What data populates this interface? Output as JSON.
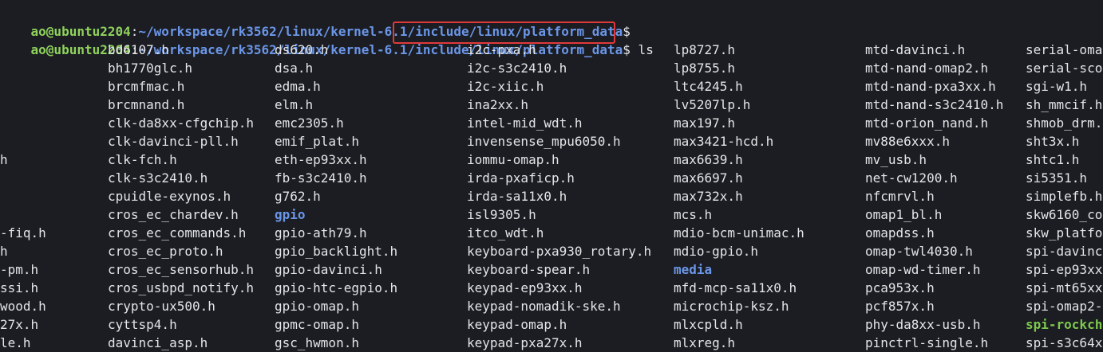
{
  "prompts": [
    {
      "user": "ao@ubuntu2204",
      "sep": ":",
      "path": "~/workspace/rk3562/linux/kernel-6.1/include/linux/platform_data",
      "symbol": "$",
      "command": ""
    },
    {
      "user": "ao@ubuntu2204",
      "sep": ":",
      "path": "~/workspace/rk3562/linux/kernel-6.1/include/linux/platform_data",
      "symbol": "$",
      "command": " ls"
    }
  ],
  "highlighted_text": "include/linux/platform_data",
  "colors": {
    "user": "#8fd25b",
    "directory": "#6b96e8",
    "executable": "#7dc94d",
    "highlight_border": "#e0393b",
    "background": "#1b1d22"
  },
  "columns": [
    {
      "entries": [
        {
          "name": ""
        },
        {
          "name": ""
        },
        {
          "name": ""
        },
        {
          "name": ""
        },
        {
          "name": ""
        },
        {
          "name": ""
        },
        {
          "name": "h"
        },
        {
          "name": ""
        },
        {
          "name": ""
        },
        {
          "name": ""
        },
        {
          "name": "-fiq.h"
        },
        {
          "name": "h"
        },
        {
          "name": "-pm.h"
        },
        {
          "name": "ssi.h"
        },
        {
          "name": "wood.h"
        },
        {
          "name": "27x.h"
        },
        {
          "name": "le.h"
        }
      ]
    },
    {
      "entries": [
        {
          "name": "bd6107.h"
        },
        {
          "name": "bh1770glc.h"
        },
        {
          "name": "brcmfmac.h"
        },
        {
          "name": "brcmnand.h"
        },
        {
          "name": "clk-da8xx-cfgchip.h"
        },
        {
          "name": "clk-davinci-pll.h"
        },
        {
          "name": "clk-fch.h"
        },
        {
          "name": "clk-s3c2410.h"
        },
        {
          "name": "cpuidle-exynos.h"
        },
        {
          "name": "cros_ec_chardev.h"
        },
        {
          "name": "cros_ec_commands.h"
        },
        {
          "name": "cros_ec_proto.h"
        },
        {
          "name": "cros_ec_sensorhub.h"
        },
        {
          "name": "cros_usbpd_notify.h"
        },
        {
          "name": "crypto-ux500.h"
        },
        {
          "name": "cyttsp4.h"
        },
        {
          "name": "davinci_asp.h"
        }
      ]
    },
    {
      "entries": [
        {
          "name": "ds620.h"
        },
        {
          "name": "dsa.h"
        },
        {
          "name": "edma.h"
        },
        {
          "name": "elm.h"
        },
        {
          "name": "emc2305.h"
        },
        {
          "name": "emif_plat.h"
        },
        {
          "name": "eth-ep93xx.h"
        },
        {
          "name": "fb-s3c2410.h"
        },
        {
          "name": "g762.h"
        },
        {
          "name": "gpio",
          "type": "dir"
        },
        {
          "name": "gpio-ath79.h"
        },
        {
          "name": "gpio_backlight.h"
        },
        {
          "name": "gpio-davinci.h"
        },
        {
          "name": "gpio-htc-egpio.h"
        },
        {
          "name": "gpio-omap.h"
        },
        {
          "name": "gpmc-omap.h"
        },
        {
          "name": "gsc_hwmon.h"
        }
      ]
    },
    {
      "entries": [
        {
          "name": "i2c-pxa.h"
        },
        {
          "name": "i2c-s3c2410.h"
        },
        {
          "name": "i2c-xiic.h"
        },
        {
          "name": "ina2xx.h"
        },
        {
          "name": "intel-mid_wdt.h"
        },
        {
          "name": "invensense_mpu6050.h"
        },
        {
          "name": "iommu-omap.h"
        },
        {
          "name": "irda-pxaficp.h"
        },
        {
          "name": "irda-sa11x0.h"
        },
        {
          "name": "isl9305.h"
        },
        {
          "name": "itco_wdt.h"
        },
        {
          "name": "keyboard-pxa930_rotary.h"
        },
        {
          "name": "keyboard-spear.h"
        },
        {
          "name": "keypad-ep93xx.h"
        },
        {
          "name": "keypad-nomadik-ske.h"
        },
        {
          "name": "keypad-omap.h"
        },
        {
          "name": "keypad-pxa27x.h"
        }
      ]
    },
    {
      "entries": [
        {
          "name": "lp8727.h"
        },
        {
          "name": "lp8755.h"
        },
        {
          "name": "ltc4245.h"
        },
        {
          "name": "lv5207lp.h"
        },
        {
          "name": "max197.h"
        },
        {
          "name": "max3421-hcd.h"
        },
        {
          "name": "max6639.h"
        },
        {
          "name": "max6697.h"
        },
        {
          "name": "max732x.h"
        },
        {
          "name": "mcs.h"
        },
        {
          "name": "mdio-bcm-unimac.h"
        },
        {
          "name": "mdio-gpio.h"
        },
        {
          "name": "media",
          "type": "dir"
        },
        {
          "name": "mfd-mcp-sa11x0.h"
        },
        {
          "name": "microchip-ksz.h"
        },
        {
          "name": "mlxcpld.h"
        },
        {
          "name": "mlxreg.h"
        }
      ]
    },
    {
      "entries": [
        {
          "name": "mtd-davinci.h"
        },
        {
          "name": "mtd-nand-omap2.h"
        },
        {
          "name": "mtd-nand-pxa3xx.h"
        },
        {
          "name": "mtd-nand-s3c2410.h"
        },
        {
          "name": "mtd-orion_nand.h"
        },
        {
          "name": "mv88e6xxx.h"
        },
        {
          "name": "mv_usb.h"
        },
        {
          "name": "net-cw1200.h"
        },
        {
          "name": "nfcmrvl.h"
        },
        {
          "name": "omap1_bl.h"
        },
        {
          "name": "omapdss.h"
        },
        {
          "name": "omap-twl4030.h"
        },
        {
          "name": "omap-wd-timer.h"
        },
        {
          "name": "pca953x.h"
        },
        {
          "name": "pcf857x.h"
        },
        {
          "name": "phy-da8xx-usb.h"
        },
        {
          "name": "pinctrl-single.h"
        }
      ]
    },
    {
      "entries": [
        {
          "name": "serial-oma"
        },
        {
          "name": "serial-sco"
        },
        {
          "name": "sgi-w1.h"
        },
        {
          "name": "sh_mmcif.h"
        },
        {
          "name": "shmob_drm."
        },
        {
          "name": "sht3x.h"
        },
        {
          "name": "shtc1.h"
        },
        {
          "name": "si5351.h"
        },
        {
          "name": "simplefb.h"
        },
        {
          "name": "skw6160_co"
        },
        {
          "name": "skw_platfo"
        },
        {
          "name": "spi-davinc"
        },
        {
          "name": "spi-ep93xx"
        },
        {
          "name": "spi-mt65xx"
        },
        {
          "name": "spi-omap2-"
        },
        {
          "name": "spi-rockch",
          "type": "exe"
        },
        {
          "name": "spi-s3c64x"
        }
      ]
    }
  ]
}
